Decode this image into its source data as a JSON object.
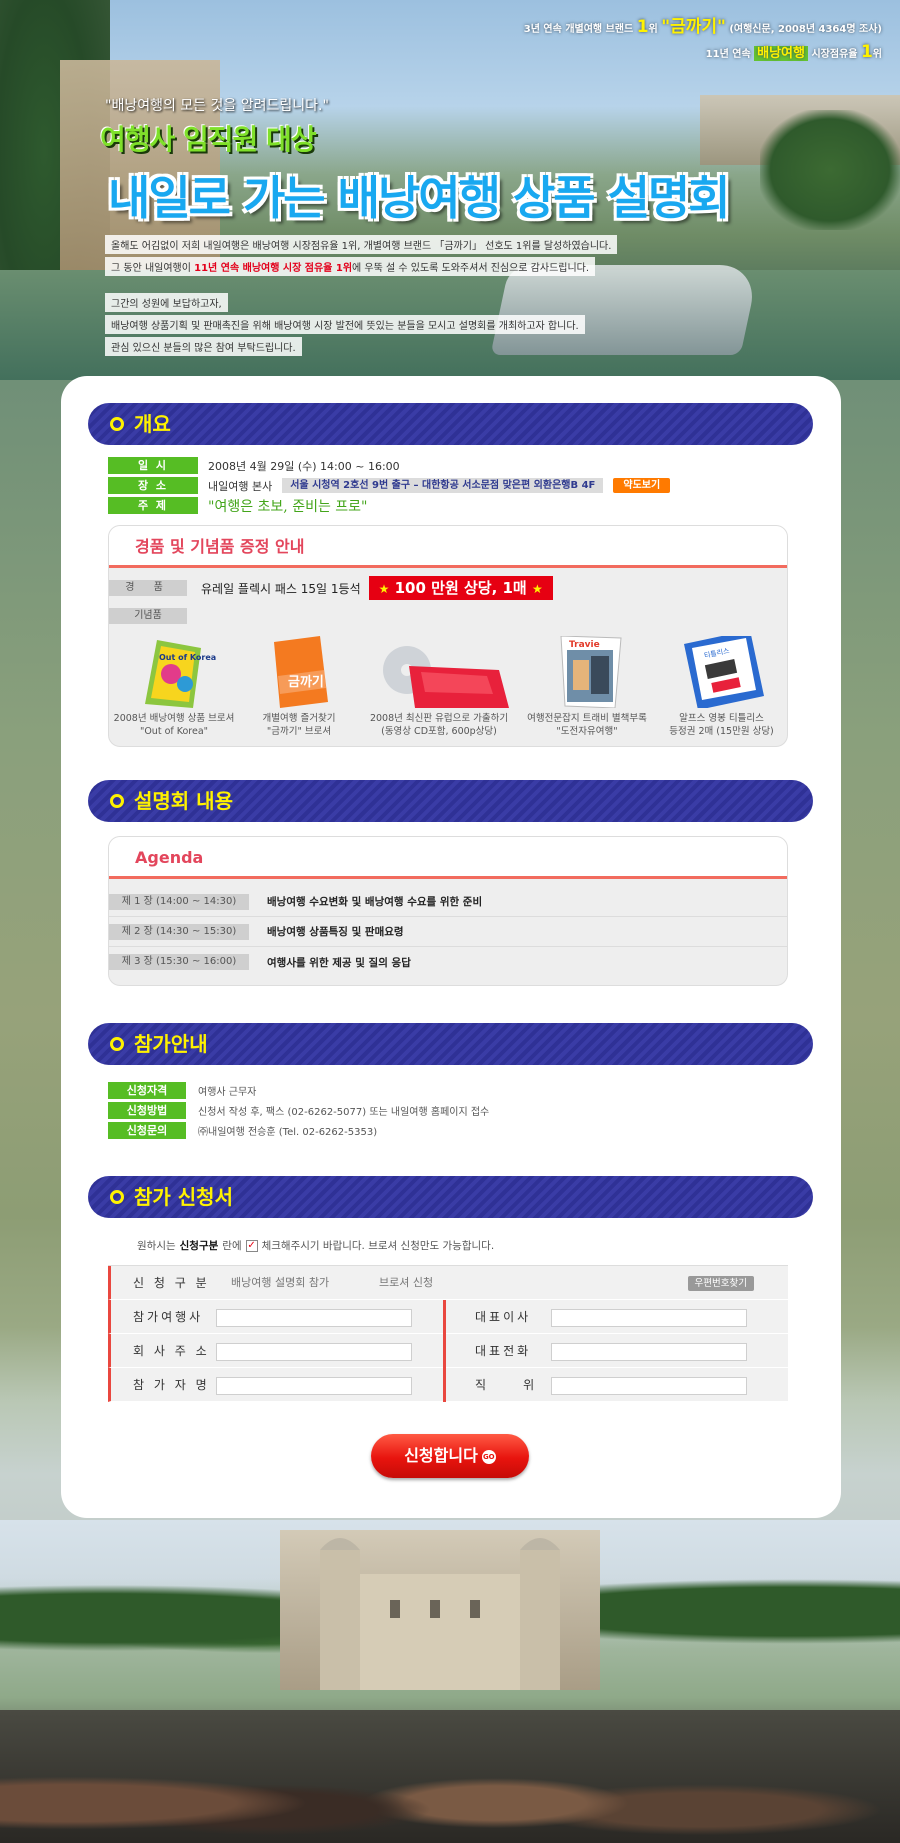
{
  "hero": {
    "award_line1_pre": "3년 연속 개별여행 브랜드 ",
    "award_line1_rank": "1",
    "award_line1_mid": "위 ",
    "award_line1_brand": "\"금까기\"",
    "award_line1_post": " (여행신문, 2008년 4364명 조사)",
    "award_line2_pre": "11년 연속 ",
    "award_line2_hl": "배낭여행",
    "award_line2_mid": " 시장점유율 ",
    "award_line2_rank": "1",
    "award_line2_post": "위",
    "kicker": "\"배낭여행의 모든 것을 알려드립니다.\"",
    "sub_title": "여행사 임직원 대상",
    "main_title": "내일로 가는 배낭여행 상품 설명회",
    "intro1": "올해도 어김없이 저희 내일여행은 배낭여행 시장점유율 1위, 개별여행 브랜드 「금까기」 선호도 1위를 달성하였습니다.",
    "intro2_pre": "그 동안 내일여행이 ",
    "intro2_red": "11년 연속 배낭여행 시장 점유율 1위",
    "intro2_post": "에 우뚝 설 수 있도록 도와주셔서 진심으로 감사드립니다.",
    "intro3": "그간의 성원에 보답하고자,",
    "intro4": "배낭여행 상품기획 및 판매촉진을 위해 배낭여행 시장 발전에 뜻있는 분들을 모시고 설명회를 개최하고자 합니다.",
    "intro5": "관심 있으신 분들의 많은 참여 부탁드립니다."
  },
  "overview": {
    "heading": "개요",
    "date_label": "일 시",
    "date_value": "2008년 4월 29일 (수) 14:00 ~ 16:00",
    "place_label": "장 소",
    "place_value": "내일여행 본사",
    "place_address": "서울 시청역 2호선 9번 출구 – 대한항공 서소문점 맞은편 외환은행B 4F",
    "map_button": "약도보기",
    "theme_label": "주 제",
    "theme_value": "\"여행은 초보, 준비는 프로\""
  },
  "prizes": {
    "title": "경품 및 기념품 증정 안내",
    "prize_label": "경 품",
    "prize_text": "유레일 플렉시 패스 15일 1등석",
    "prize_badge": "100 만원 상당, 1매",
    "gift_label": "기념품",
    "gifts": [
      {
        "cap1": "2008년 배낭여행 상품 브로셔",
        "cap2": "\"Out of Korea\""
      },
      {
        "cap1": "개별여행 즐거찾기",
        "cap2": "\"금까기\" 브로셔"
      },
      {
        "cap1": "2008년 최신판 유럽으로 가출하기",
        "cap2": "(동영상 CD포함, 600p상당)"
      },
      {
        "cap1": "여행전문잡지 트래비 별책부록",
        "cap2": "\"도전자유여행\""
      },
      {
        "cap1": "알프스 영봉 티틀리스",
        "cap2": "등정권 2매 (15만원 상당)"
      }
    ],
    "book1_text": "Out of Korea",
    "book2_text": "금까기",
    "book4_text": "Travie",
    "book5_text": "티틀리스"
  },
  "content": {
    "heading": "설명회 내용",
    "agenda_title": "Agenda",
    "rows": [
      {
        "session": "제 1 장 (14:00 ~ 14:30)",
        "text": "배낭여행 수요변화 및 배낭여행 수요를 위한 준비"
      },
      {
        "session": "제 2 장 (14:30 ~ 15:30)",
        "text": "배낭여행 상품특징 및 판매요령"
      },
      {
        "session": "제 3 장 (15:30 ~ 16:00)",
        "text": "여행사를 위한 제공 및 질의 응답"
      }
    ]
  },
  "participation": {
    "heading": "참가안내",
    "rows": [
      {
        "label": "신청자격",
        "value": "여행사 근무자"
      },
      {
        "label": "신청방법",
        "value": "신청서 작성 후, 팩스 (02-6262-5077) 또는 내일여행 홈페이지 접수"
      },
      {
        "label": "신청문의",
        "value": "㈜내일여행 전승훈  (Tel. 02-6262-5353)"
      }
    ]
  },
  "application": {
    "heading": "참가 신청서",
    "note_pre": "원하시는 ",
    "note_bold": "신청구분",
    "note_mid": "란에",
    "note_check": "✓",
    "note_post": "체크해주시기 바랍니다. 브로셔 신청만도 가능합니다.",
    "type_label": "신 청 구 분",
    "option1": "배낭여행 설명회 참가",
    "option2": "브로셔 신청",
    "zip_button": "우편번호찾기",
    "agency_label": "참가여행사",
    "ceo_label": "대표이사",
    "address_label": "회 사 주 소",
    "phone_label": "대표전화",
    "name_label": "참 가 자 명",
    "position_label": "직     위",
    "submit": "신청합니다",
    "submit_go": "GO"
  },
  "colors": {
    "section_bar": "#2f3196",
    "section_text": "#fff200",
    "tag_green": "#56bd24",
    "accent_red": "#e60012",
    "title_blue": "#19a8f0"
  }
}
